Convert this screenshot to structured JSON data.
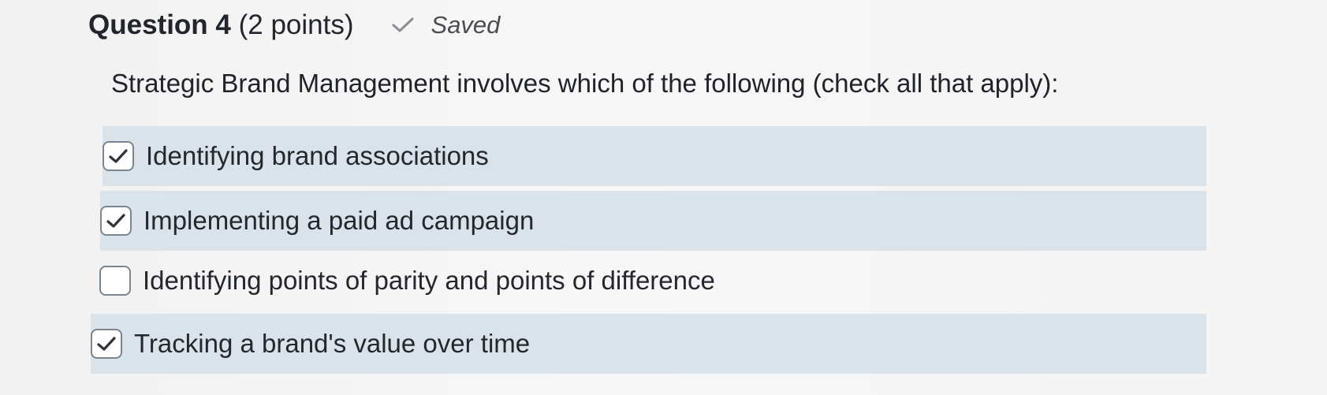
{
  "question": {
    "number_label": "Question 4",
    "points_label": "(2 points)",
    "status_label": "Saved",
    "status_icon": "checkmark-icon",
    "prompt": "Strategic Brand Management involves which of the following (check all that apply):"
  },
  "options": [
    {
      "label": "Identifying brand associations",
      "checked": true
    },
    {
      "label": "Implementing a paid ad campaign",
      "checked": true
    },
    {
      "label": "Identifying points of parity and points of difference",
      "checked": false
    },
    {
      "label": "Tracking a brand's value over time",
      "checked": true
    }
  ],
  "colors": {
    "selected_row_background": "#dbe3ea",
    "checkbox_border": "#7b858f",
    "checkmark": "#2f3339"
  }
}
